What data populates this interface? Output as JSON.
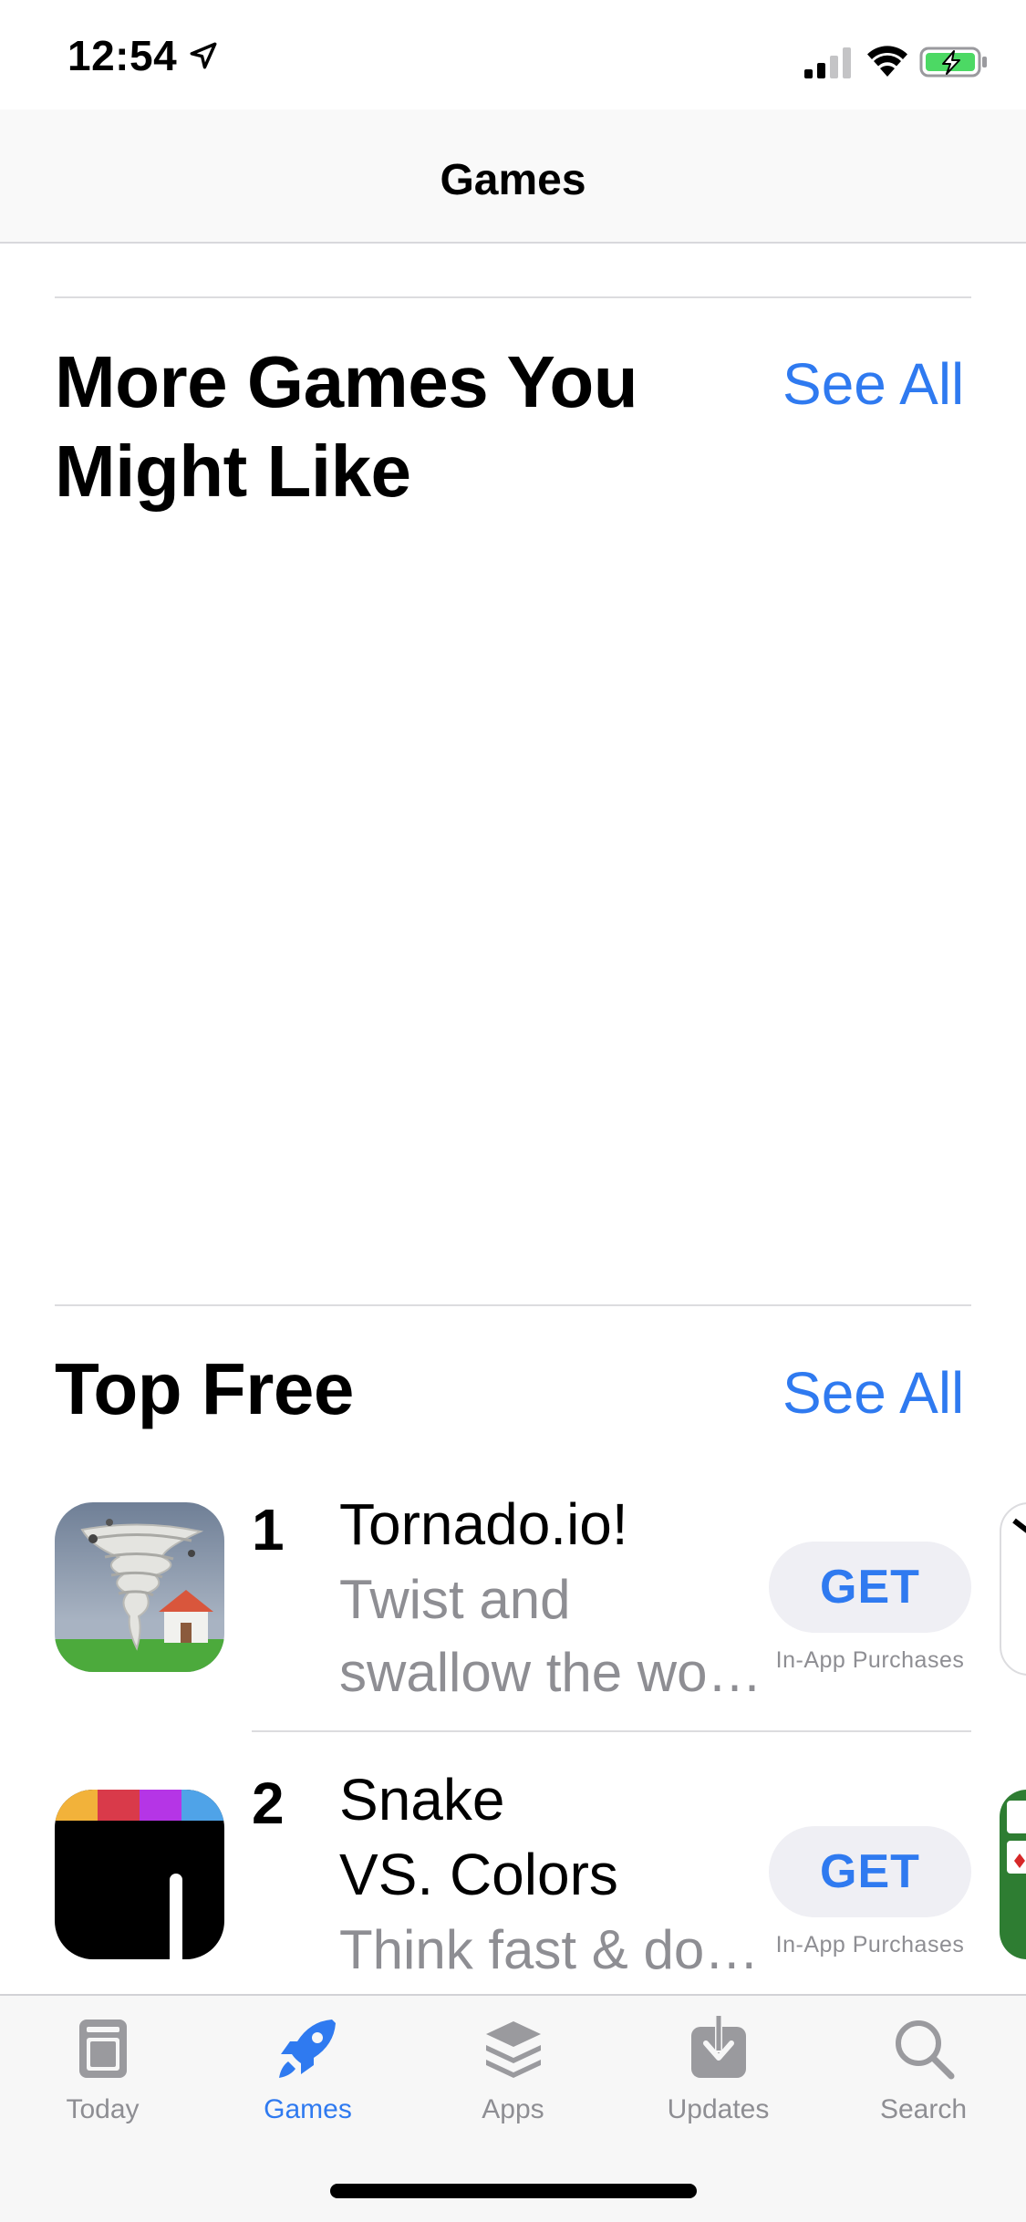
{
  "status_bar": {
    "time": "12:54"
  },
  "nav": {
    "title": "Games"
  },
  "sections": [
    {
      "title": "More Games You Might Like",
      "see_all": "See All"
    },
    {
      "title": "Top Free",
      "see_all": "See All"
    }
  ],
  "apps": [
    {
      "rank": "1",
      "name": "Tornado.io!",
      "subtitle_line1": "Twist and",
      "subtitle_line2": "swallow the wo…",
      "button": "GET",
      "note": "In-App Purchases"
    },
    {
      "rank": "2",
      "name_line1": "Snake",
      "name_line2": "VS. Colors",
      "subtitle_line1": "Think fast & do…",
      "button": "GET",
      "note": "In-App Purchases"
    }
  ],
  "tabs": [
    {
      "label": "Today",
      "icon": "today-icon",
      "active": false
    },
    {
      "label": "Games",
      "icon": "rocket-icon",
      "active": true
    },
    {
      "label": "Apps",
      "icon": "layers-icon",
      "active": false
    },
    {
      "label": "Updates",
      "icon": "download-icon",
      "active": false
    },
    {
      "label": "Search",
      "icon": "search-icon",
      "active": false
    }
  ],
  "colors": {
    "accent": "#2f7af0",
    "secondary_text": "#8e8e93",
    "button_bg": "#efeff4"
  }
}
